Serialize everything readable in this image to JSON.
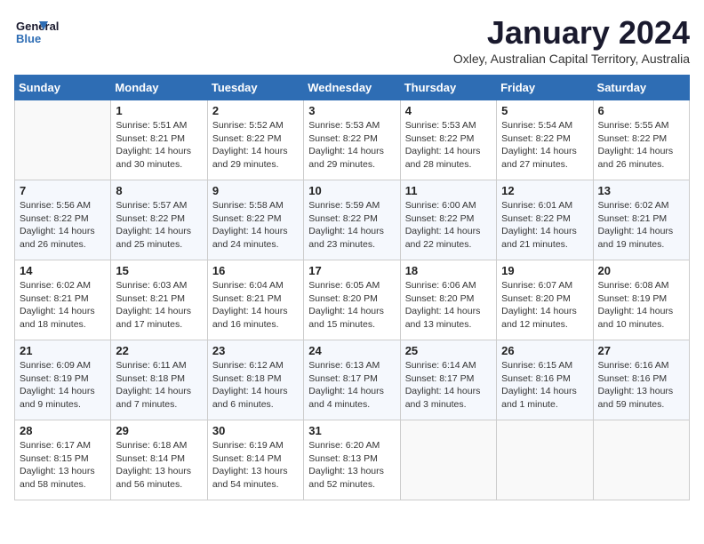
{
  "logo": {
    "line1": "General",
    "line2": "Blue"
  },
  "title": "January 2024",
  "subtitle": "Oxley, Australian Capital Territory, Australia",
  "weekdays": [
    "Sunday",
    "Monday",
    "Tuesday",
    "Wednesday",
    "Thursday",
    "Friday",
    "Saturday"
  ],
  "weeks": [
    [
      {
        "day": "",
        "sunrise": "",
        "sunset": "",
        "daylight": ""
      },
      {
        "day": "1",
        "sunrise": "Sunrise: 5:51 AM",
        "sunset": "Sunset: 8:21 PM",
        "daylight": "Daylight: 14 hours and 30 minutes."
      },
      {
        "day": "2",
        "sunrise": "Sunrise: 5:52 AM",
        "sunset": "Sunset: 8:22 PM",
        "daylight": "Daylight: 14 hours and 29 minutes."
      },
      {
        "day": "3",
        "sunrise": "Sunrise: 5:53 AM",
        "sunset": "Sunset: 8:22 PM",
        "daylight": "Daylight: 14 hours and 29 minutes."
      },
      {
        "day": "4",
        "sunrise": "Sunrise: 5:53 AM",
        "sunset": "Sunset: 8:22 PM",
        "daylight": "Daylight: 14 hours and 28 minutes."
      },
      {
        "day": "5",
        "sunrise": "Sunrise: 5:54 AM",
        "sunset": "Sunset: 8:22 PM",
        "daylight": "Daylight: 14 hours and 27 minutes."
      },
      {
        "day": "6",
        "sunrise": "Sunrise: 5:55 AM",
        "sunset": "Sunset: 8:22 PM",
        "daylight": "Daylight: 14 hours and 26 minutes."
      }
    ],
    [
      {
        "day": "7",
        "sunrise": "Sunrise: 5:56 AM",
        "sunset": "Sunset: 8:22 PM",
        "daylight": "Daylight: 14 hours and 26 minutes."
      },
      {
        "day": "8",
        "sunrise": "Sunrise: 5:57 AM",
        "sunset": "Sunset: 8:22 PM",
        "daylight": "Daylight: 14 hours and 25 minutes."
      },
      {
        "day": "9",
        "sunrise": "Sunrise: 5:58 AM",
        "sunset": "Sunset: 8:22 PM",
        "daylight": "Daylight: 14 hours and 24 minutes."
      },
      {
        "day": "10",
        "sunrise": "Sunrise: 5:59 AM",
        "sunset": "Sunset: 8:22 PM",
        "daylight": "Daylight: 14 hours and 23 minutes."
      },
      {
        "day": "11",
        "sunrise": "Sunrise: 6:00 AM",
        "sunset": "Sunset: 8:22 PM",
        "daylight": "Daylight: 14 hours and 22 minutes."
      },
      {
        "day": "12",
        "sunrise": "Sunrise: 6:01 AM",
        "sunset": "Sunset: 8:22 PM",
        "daylight": "Daylight: 14 hours and 21 minutes."
      },
      {
        "day": "13",
        "sunrise": "Sunrise: 6:02 AM",
        "sunset": "Sunset: 8:21 PM",
        "daylight": "Daylight: 14 hours and 19 minutes."
      }
    ],
    [
      {
        "day": "14",
        "sunrise": "Sunrise: 6:02 AM",
        "sunset": "Sunset: 8:21 PM",
        "daylight": "Daylight: 14 hours and 18 minutes."
      },
      {
        "day": "15",
        "sunrise": "Sunrise: 6:03 AM",
        "sunset": "Sunset: 8:21 PM",
        "daylight": "Daylight: 14 hours and 17 minutes."
      },
      {
        "day": "16",
        "sunrise": "Sunrise: 6:04 AM",
        "sunset": "Sunset: 8:21 PM",
        "daylight": "Daylight: 14 hours and 16 minutes."
      },
      {
        "day": "17",
        "sunrise": "Sunrise: 6:05 AM",
        "sunset": "Sunset: 8:20 PM",
        "daylight": "Daylight: 14 hours and 15 minutes."
      },
      {
        "day": "18",
        "sunrise": "Sunrise: 6:06 AM",
        "sunset": "Sunset: 8:20 PM",
        "daylight": "Daylight: 14 hours and 13 minutes."
      },
      {
        "day": "19",
        "sunrise": "Sunrise: 6:07 AM",
        "sunset": "Sunset: 8:20 PM",
        "daylight": "Daylight: 14 hours and 12 minutes."
      },
      {
        "day": "20",
        "sunrise": "Sunrise: 6:08 AM",
        "sunset": "Sunset: 8:19 PM",
        "daylight": "Daylight: 14 hours and 10 minutes."
      }
    ],
    [
      {
        "day": "21",
        "sunrise": "Sunrise: 6:09 AM",
        "sunset": "Sunset: 8:19 PM",
        "daylight": "Daylight: 14 hours and 9 minutes."
      },
      {
        "day": "22",
        "sunrise": "Sunrise: 6:11 AM",
        "sunset": "Sunset: 8:18 PM",
        "daylight": "Daylight: 14 hours and 7 minutes."
      },
      {
        "day": "23",
        "sunrise": "Sunrise: 6:12 AM",
        "sunset": "Sunset: 8:18 PM",
        "daylight": "Daylight: 14 hours and 6 minutes."
      },
      {
        "day": "24",
        "sunrise": "Sunrise: 6:13 AM",
        "sunset": "Sunset: 8:17 PM",
        "daylight": "Daylight: 14 hours and 4 minutes."
      },
      {
        "day": "25",
        "sunrise": "Sunrise: 6:14 AM",
        "sunset": "Sunset: 8:17 PM",
        "daylight": "Daylight: 14 hours and 3 minutes."
      },
      {
        "day": "26",
        "sunrise": "Sunrise: 6:15 AM",
        "sunset": "Sunset: 8:16 PM",
        "daylight": "Daylight: 14 hours and 1 minute."
      },
      {
        "day": "27",
        "sunrise": "Sunrise: 6:16 AM",
        "sunset": "Sunset: 8:16 PM",
        "daylight": "Daylight: 13 hours and 59 minutes."
      }
    ],
    [
      {
        "day": "28",
        "sunrise": "Sunrise: 6:17 AM",
        "sunset": "Sunset: 8:15 PM",
        "daylight": "Daylight: 13 hours and 58 minutes."
      },
      {
        "day": "29",
        "sunrise": "Sunrise: 6:18 AM",
        "sunset": "Sunset: 8:14 PM",
        "daylight": "Daylight: 13 hours and 56 minutes."
      },
      {
        "day": "30",
        "sunrise": "Sunrise: 6:19 AM",
        "sunset": "Sunset: 8:14 PM",
        "daylight": "Daylight: 13 hours and 54 minutes."
      },
      {
        "day": "31",
        "sunrise": "Sunrise: 6:20 AM",
        "sunset": "Sunset: 8:13 PM",
        "daylight": "Daylight: 13 hours and 52 minutes."
      },
      {
        "day": "",
        "sunrise": "",
        "sunset": "",
        "daylight": ""
      },
      {
        "day": "",
        "sunrise": "",
        "sunset": "",
        "daylight": ""
      },
      {
        "day": "",
        "sunrise": "",
        "sunset": "",
        "daylight": ""
      }
    ]
  ]
}
